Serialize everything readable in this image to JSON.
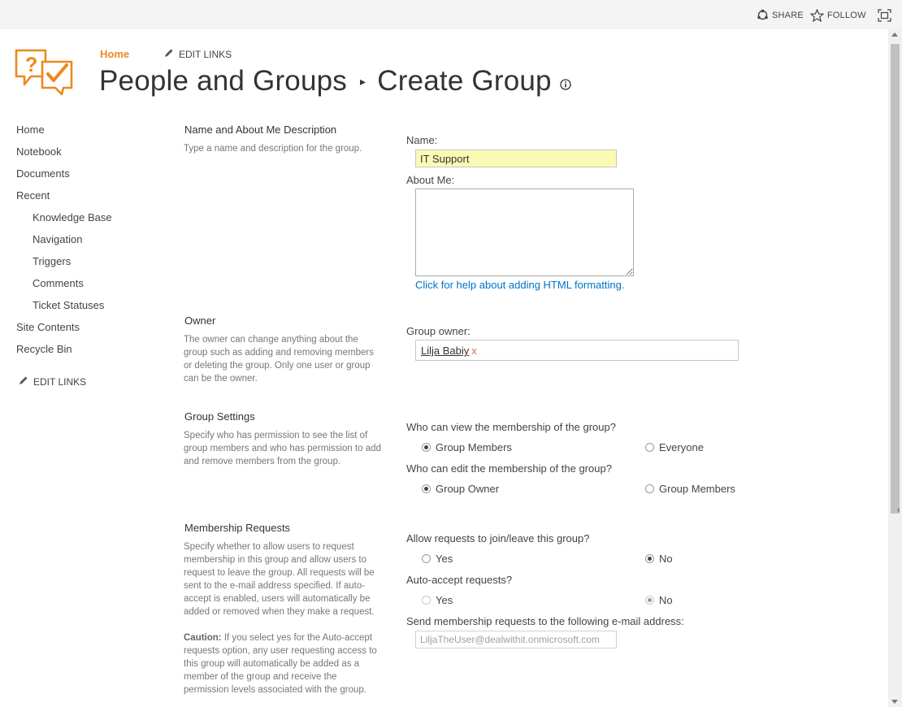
{
  "suitebar": {
    "share_label": "SHARE",
    "follow_label": "FOLLOW"
  },
  "topnav": {
    "home_label": "Home",
    "edit_links_label": "EDIT LINKS"
  },
  "title": {
    "parent": "People and Groups",
    "current": "Create Group"
  },
  "left_nav": {
    "items": [
      {
        "label": "Home"
      },
      {
        "label": "Notebook"
      },
      {
        "label": "Documents"
      },
      {
        "label": "Recent"
      },
      {
        "label": "Knowledge Base"
      },
      {
        "label": "Navigation"
      },
      {
        "label": "Triggers"
      },
      {
        "label": "Comments"
      },
      {
        "label": "Ticket Statuses"
      },
      {
        "label": "Site Contents"
      },
      {
        "label": "Recycle Bin"
      }
    ],
    "edit_links_label": "EDIT LINKS"
  },
  "sections": {
    "name": {
      "title": "Name and About Me Description",
      "description": "Type a name and description for the group.",
      "name_label": "Name:",
      "name_value": "IT Support",
      "about_label": "About Me:",
      "about_value": "",
      "help_link": "Click for help about adding HTML formatting."
    },
    "owner": {
      "title": "Owner",
      "description": "The owner can change anything about the group such as adding and removing members or deleting the group. Only one user or group can be the owner.",
      "owner_label": "Group owner:",
      "owner_value": "Lilja Babiy",
      "remove_glyph": "x"
    },
    "settings": {
      "title": "Group Settings",
      "description": "Specify who has permission to see the list of group members and who has permission to add and remove members from the group.",
      "view_question": "Who can view the membership of the group?",
      "view_options": [
        "Group Members",
        "Everyone"
      ],
      "view_selected": "Group Members",
      "edit_question": "Who can edit the membership of the group?",
      "edit_options": [
        "Group Owner",
        "Group Members"
      ],
      "edit_selected": "Group Owner"
    },
    "membership": {
      "title": "Membership Requests",
      "description": "Specify whether to allow users to request membership in this group and allow users to request to leave the group. All requests will be sent to the e-mail address specified. If auto-accept is enabled, users will automatically be added or removed when they make a request.",
      "caution_label": "Caution:",
      "caution_text": " If you select yes for the Auto-accept requests option, any user requesting access to this group will automatically be added as a member of the group and receive the permission levels associated with the group.",
      "allow_question": "Allow requests to join/leave this group?",
      "allow_options": [
        "Yes",
        "No"
      ],
      "allow_selected": "No",
      "auto_question": "Auto-accept requests?",
      "auto_options": [
        "Yes",
        "No"
      ],
      "auto_selected": "No",
      "email_label": "Send membership requests to the following e-mail address:",
      "email_value": "LiljaTheUser@dealwithit.onmicrosoft.com"
    }
  },
  "colors": {
    "accent_orange": "#ea8a1c",
    "link_blue": "#0072c6",
    "name_input_bg": "#fafab4"
  }
}
